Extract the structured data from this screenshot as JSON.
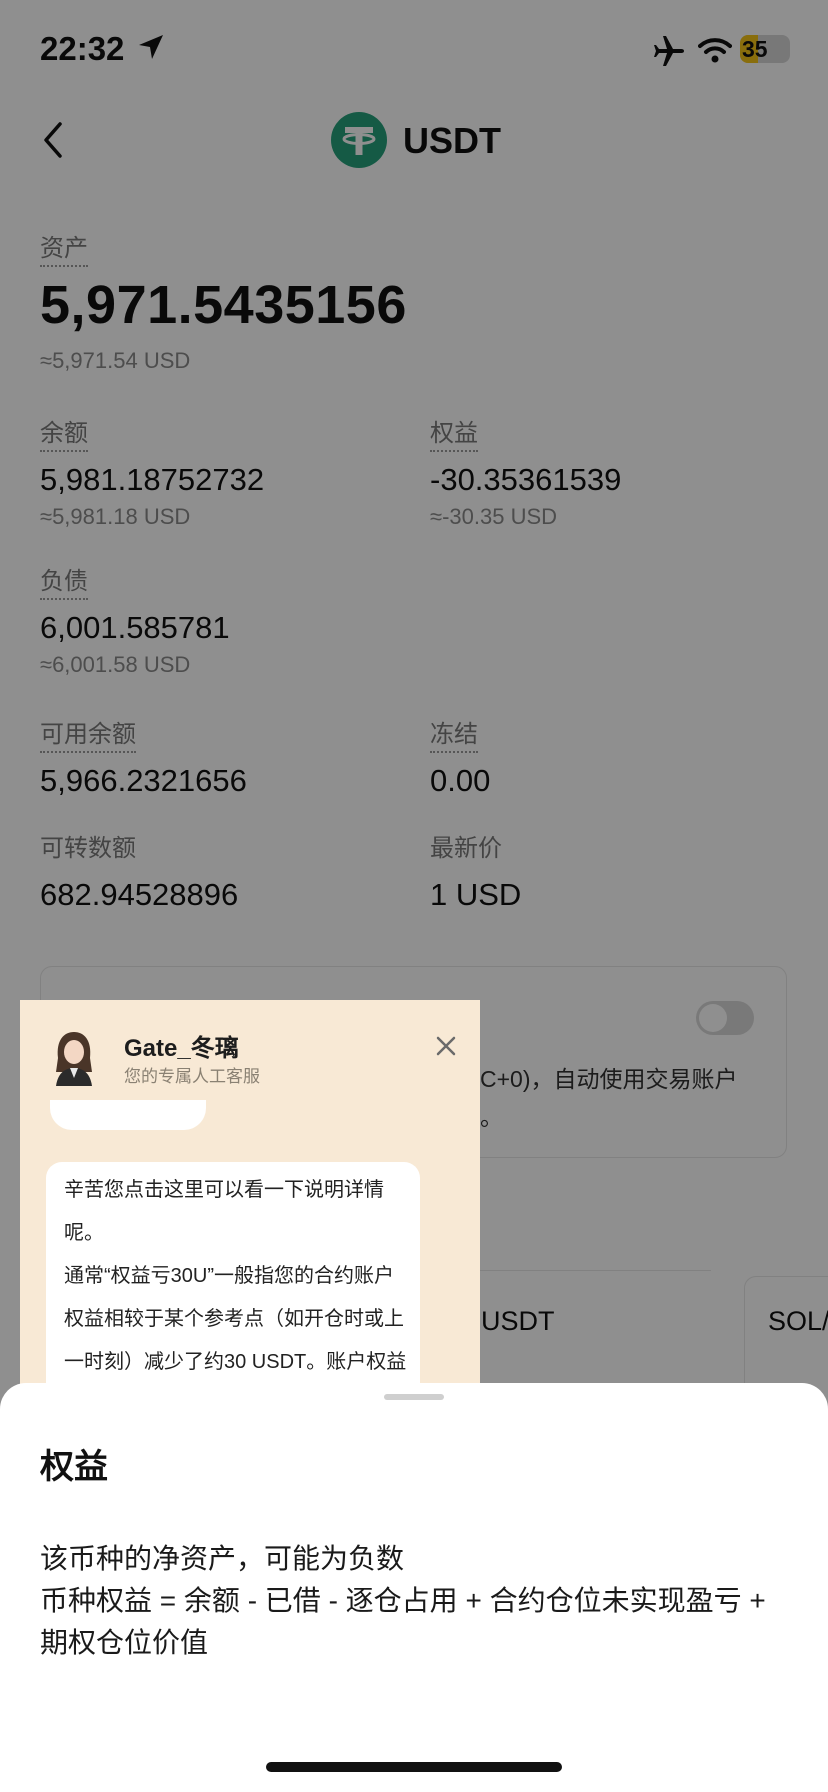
{
  "status_bar": {
    "time": "22:32",
    "battery": "35",
    "battery_level": 0.35
  },
  "header": {
    "title": "USDT"
  },
  "assets": {
    "label": "资产",
    "value": "5,971.5435156",
    "usd": "≈5,971.54 USD"
  },
  "balance": {
    "label": "余额",
    "value": "5,981.18752732",
    "usd": "≈5,981.18 USD"
  },
  "equity": {
    "label": "权益",
    "value": "-30.35361539",
    "usd": "≈-30.35 USD"
  },
  "liability": {
    "label": "负债",
    "value": "6,001.585781",
    "usd": "≈6,001.58 USD"
  },
  "available": {
    "label": "可用余额",
    "value": "5,966.2321656"
  },
  "frozen": {
    "label": "冻结",
    "value": "0.00"
  },
  "transferable": {
    "label": "可转数额",
    "value": "682.94528896"
  },
  "latest_price": {
    "label": "最新价",
    "value": "1 USD"
  },
  "setting_card": {
    "line1": "C+0)，自动使用交易账户",
    "line2": "。"
  },
  "asset_cards": [
    {
      "label": "USDT"
    },
    {
      "label": "SOL/"
    }
  ],
  "chat": {
    "agent_name": "Gate_冬璃",
    "agent_sub": "您的专属人工客服",
    "lines": [
      "辛苦您点击这里可以看一下说明详情",
      "呢。",
      "通常“权益亏30U”一般指您的合约账户",
      "权益相较于某个参考点（如开仓时或上",
      "一时刻）减少了约30 USDT。账户权益"
    ]
  },
  "sheet": {
    "title": "权益",
    "lines": [
      "该币种的净资产，可能为负数",
      "币种权益 = 余额 - 已借 - 逐仓占用 + 合约仓位未实现盈亏 +",
      "期权仓位价值"
    ]
  },
  "colors": {
    "tether_green": "#26a17b",
    "chat_bg": "#feeed9",
    "battery_yellow": "#f5c518"
  }
}
